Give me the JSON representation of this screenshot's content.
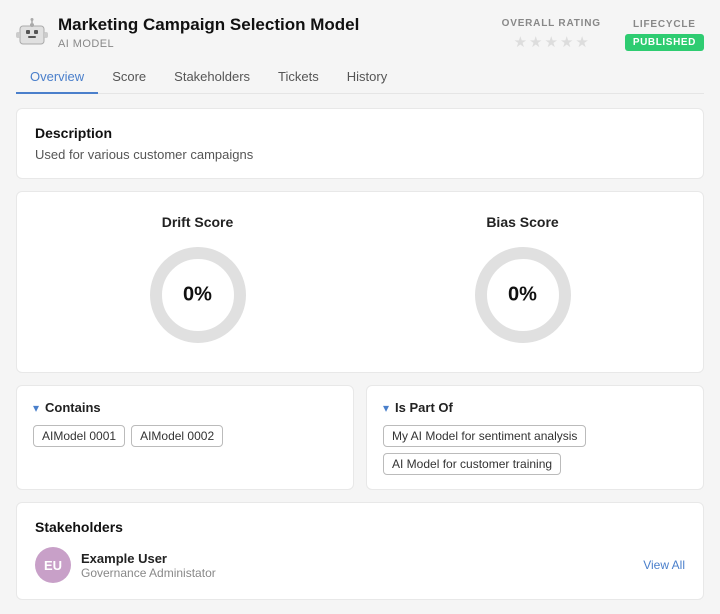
{
  "header": {
    "title": "Marketing Campaign Selection Model",
    "subtitle": "AI MODEL",
    "rating_label": "OVERALL RATING",
    "lifecycle_label": "LIFECYCLE",
    "lifecycle_badge": "PUBLISHED",
    "stars": [
      "★",
      "★",
      "★",
      "★",
      "★"
    ]
  },
  "tabs": [
    {
      "label": "Overview",
      "active": true
    },
    {
      "label": "Score",
      "active": false
    },
    {
      "label": "Stakeholders",
      "active": false
    },
    {
      "label": "Tickets",
      "active": false
    },
    {
      "label": "History",
      "active": false
    }
  ],
  "description": {
    "title": "Description",
    "text": "Used for various customer campaigns"
  },
  "drift_score": {
    "label": "Drift Score",
    "value": "0%"
  },
  "bias_score": {
    "label": "Bias Score",
    "value": "0%"
  },
  "contains": {
    "title": "Contains",
    "items": [
      "AIModel 0001",
      "AIModel 0002"
    ]
  },
  "is_part_of": {
    "title": "Is Part Of",
    "items": [
      "My AI Model for sentiment analysis",
      "AI Model for customer training"
    ]
  },
  "stakeholders": {
    "title": "Stakeholders",
    "user": {
      "initials": "EU",
      "name": "Example User",
      "role": "Governance Administator"
    },
    "view_all": "View All"
  }
}
